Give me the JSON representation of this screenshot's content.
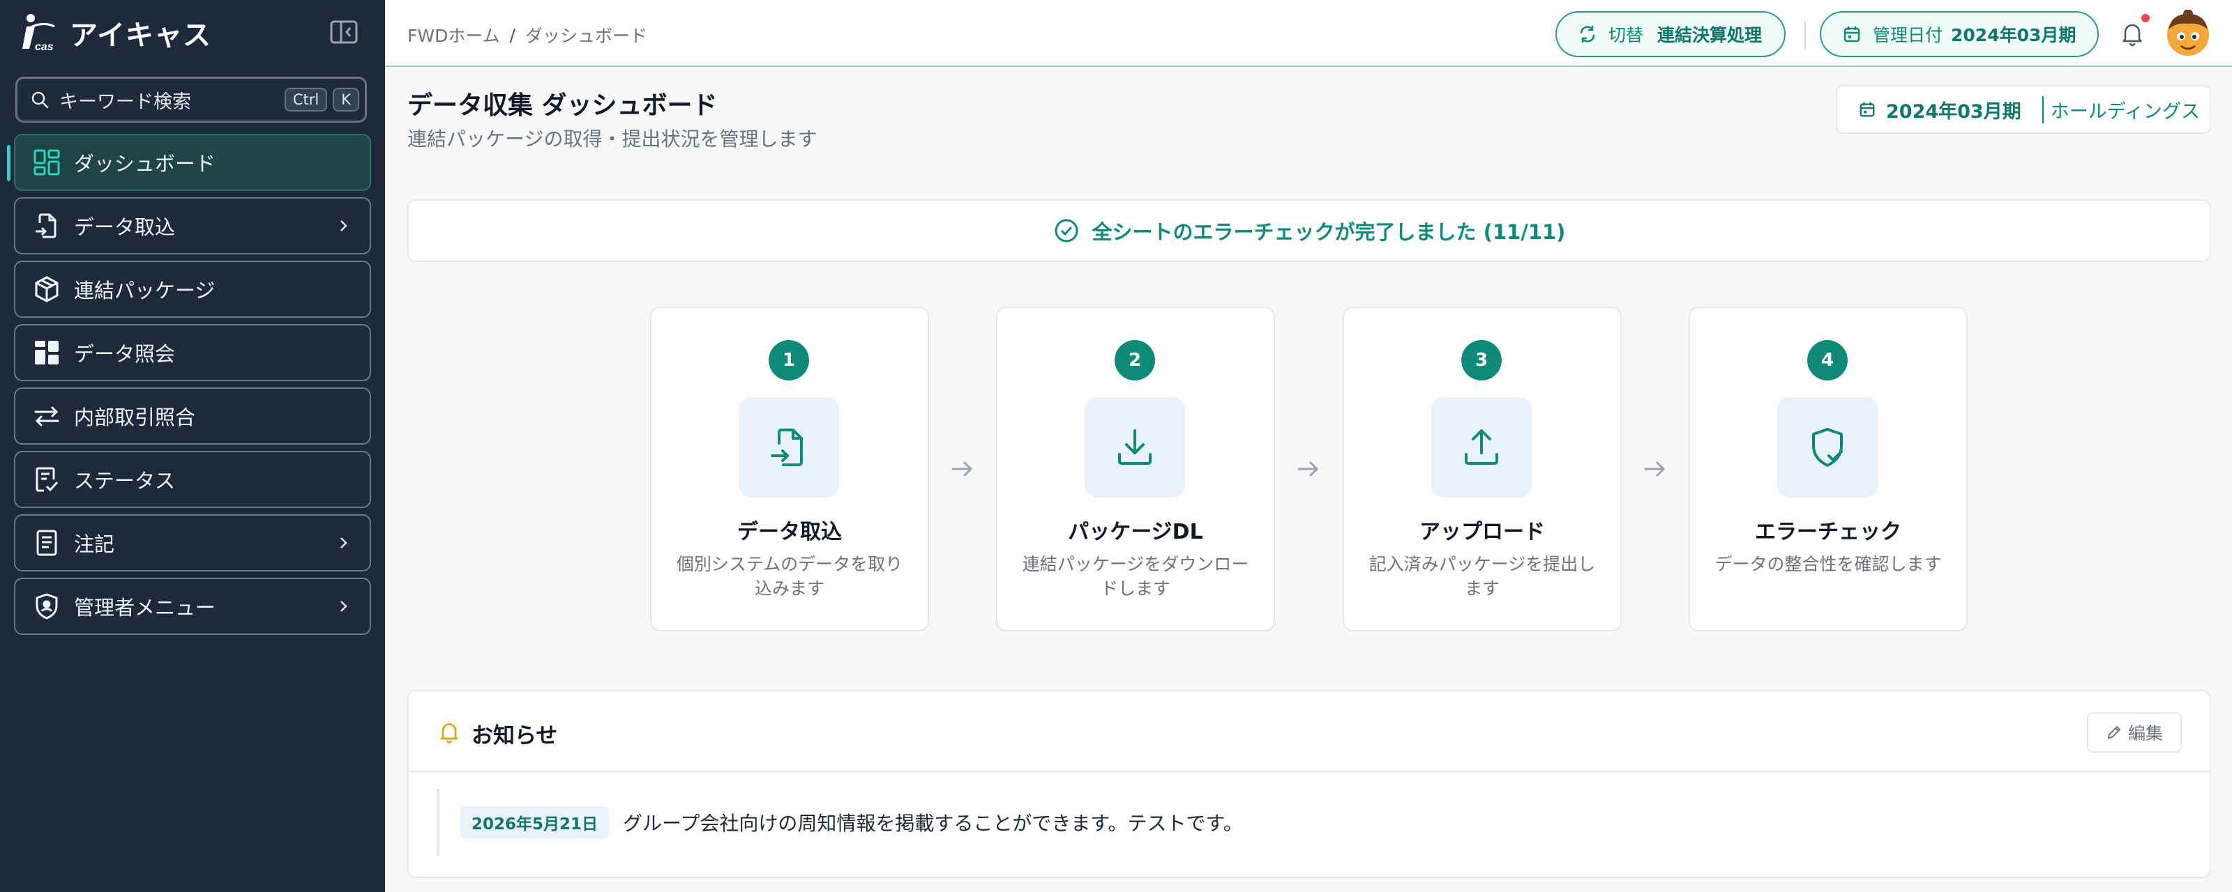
{
  "app": {
    "brand_name": "アイキャス",
    "logo_text": "iCAS"
  },
  "sidebar": {
    "search": {
      "placeholder": "キーワード検索",
      "shortcut_keys": [
        "Ctrl",
        "K"
      ]
    },
    "items": [
      {
        "label": "ダッシュボード",
        "icon": "dashboard-icon",
        "active": true,
        "has_chevron": false
      },
      {
        "label": "データ取込",
        "icon": "file-import-icon",
        "active": false,
        "has_chevron": true
      },
      {
        "label": "連結パッケージ",
        "icon": "package-icon",
        "active": false,
        "has_chevron": false
      },
      {
        "label": "データ照会",
        "icon": "table-grid-icon",
        "active": false,
        "has_chevron": false
      },
      {
        "label": "内部取引照合",
        "icon": "transfer-icon",
        "active": false,
        "has_chevron": false
      },
      {
        "label": "ステータス",
        "icon": "status-clipboard-icon",
        "active": false,
        "has_chevron": false
      },
      {
        "label": "注記",
        "icon": "document-icon",
        "active": false,
        "has_chevron": true
      },
      {
        "label": "管理者メニュー",
        "icon": "shield-icon",
        "active": false,
        "has_chevron": true
      }
    ]
  },
  "header": {
    "breadcrumb": [
      "FWDホーム",
      "ダッシュボード"
    ],
    "breadcrumb_separator": "/",
    "switch_pill": {
      "label": "切替",
      "value": "連結決算処理"
    },
    "date_pill": {
      "label": "管理日付",
      "value": "2024年03月期"
    }
  },
  "main": {
    "title": "データ収集 ダッシュボード",
    "subtitle": "連結パッケージの取得・提出状況を管理します",
    "period": {
      "value": "2024年03月期",
      "company": "ホールディングス"
    },
    "banner": "全シートのエラーチェックが完了しました (11/11)",
    "steps": [
      {
        "num": "1",
        "title": "データ取込",
        "desc": "個別システムのデータを取り込みます",
        "icon": "file-import-icon"
      },
      {
        "num": "2",
        "title": "パッケージDL",
        "desc": "連結パッケージをダウンロードします",
        "icon": "download-icon"
      },
      {
        "num": "3",
        "title": "アップロード",
        "desc": "記入済みパッケージを提出します",
        "icon": "upload-icon"
      },
      {
        "num": "4",
        "title": "エラーチェック",
        "desc": "データの整合性を確認します",
        "icon": "shield-check-icon"
      }
    ],
    "notice": {
      "title": "お知らせ",
      "edit_label": "編集",
      "items": [
        {
          "date": "2026年5月21日",
          "text": "グループ会社向けの周知情報を掲載することができます。テストです。"
        }
      ]
    }
  },
  "colors": {
    "sidebar_bg": "#1e293b",
    "accent": "#0f8a78",
    "active_item_bg": "#1f4546",
    "notification_dot": "#ef4444"
  }
}
